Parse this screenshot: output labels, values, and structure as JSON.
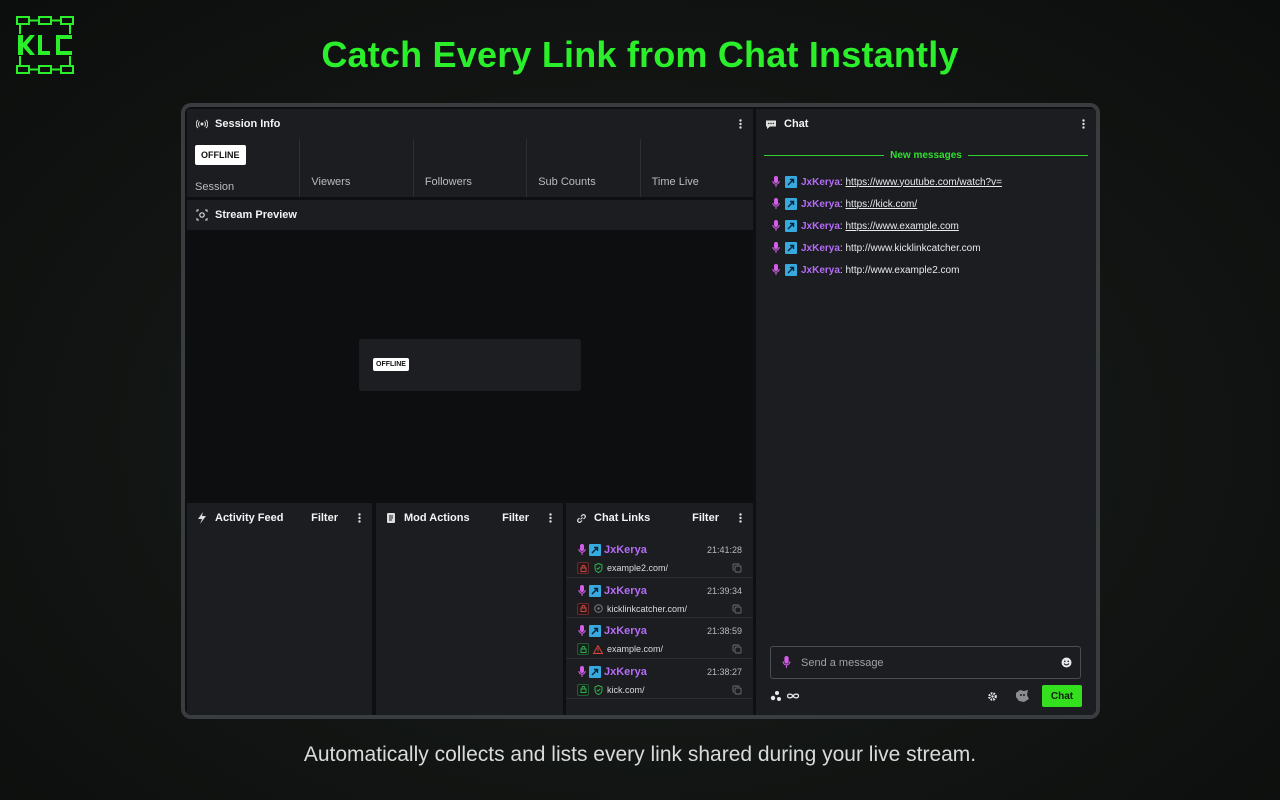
{
  "headline": "Catch Every Link from Chat Instantly",
  "subline": "Automatically collects and lists every link shared during your live stream.",
  "session_info": {
    "title": "Session Info",
    "status_badge": "OFFLINE",
    "stats": [
      {
        "label": "Session"
      },
      {
        "label": "Viewers"
      },
      {
        "label": "Followers"
      },
      {
        "label": "Sub Counts"
      },
      {
        "label": "Time Live"
      }
    ]
  },
  "stream_preview": {
    "title": "Stream Preview",
    "status_badge": "OFFLINE"
  },
  "activity_feed": {
    "title": "Activity Feed",
    "filter_label": "Filter"
  },
  "mod_actions": {
    "title": "Mod Actions",
    "filter_label": "Filter"
  },
  "chat_links": {
    "title": "Chat Links",
    "filter_label": "Filter",
    "items": [
      {
        "user": "JxKerya",
        "time": "21:41:28",
        "url": "example2.com/",
        "lock": "red",
        "status": "safe"
      },
      {
        "user": "JxKerya",
        "time": "21:39:34",
        "url": "kicklinkcatcher.com/",
        "lock": "red",
        "status": "unknown"
      },
      {
        "user": "JxKerya",
        "time": "21:38:59",
        "url": "example.com/",
        "lock": "green",
        "status": "warning"
      },
      {
        "user": "JxKerya",
        "time": "21:38:27",
        "url": "kick.com/",
        "lock": "green",
        "status": "safe"
      }
    ]
  },
  "chat": {
    "title": "Chat",
    "new_messages_label": "New messages",
    "messages": [
      {
        "user": "JxKerya",
        "text": "https://www.youtube.com/watch?v=",
        "is_link": true
      },
      {
        "user": "JxKerya",
        "text": "https://kick.com/",
        "is_link": true
      },
      {
        "user": "JxKerya",
        "text": "https://www.example.com",
        "is_link": true
      },
      {
        "user": "JxKerya",
        "text": "http://www.kicklinkcatcher.com",
        "is_link": false
      },
      {
        "user": "JxKerya",
        "text": "http://www.example2.com",
        "is_link": false
      }
    ],
    "input_placeholder": "Send a message",
    "send_button_label": "Chat"
  },
  "colors": {
    "accent_green": "#2bef2b",
    "username_purple": "#b56cf7",
    "kick_badge_blue": "#36a9e0",
    "mic_badge_pink": "#d35ce8",
    "status_safe": "#2fb54a",
    "status_warning": "#e0443a",
    "lock_red": "#d94a4a",
    "lock_green": "#35b55a"
  },
  "icons": {
    "logo": "klc-logo-icon",
    "session_info": "broadcast-icon",
    "stream_preview": "webcam-icon",
    "activity_feed": "lightning-icon",
    "mod_actions": "document-icon",
    "chat_links": "link-icon",
    "chat": "chat-bubble-icon",
    "menu": "kebab-menu-icon"
  }
}
